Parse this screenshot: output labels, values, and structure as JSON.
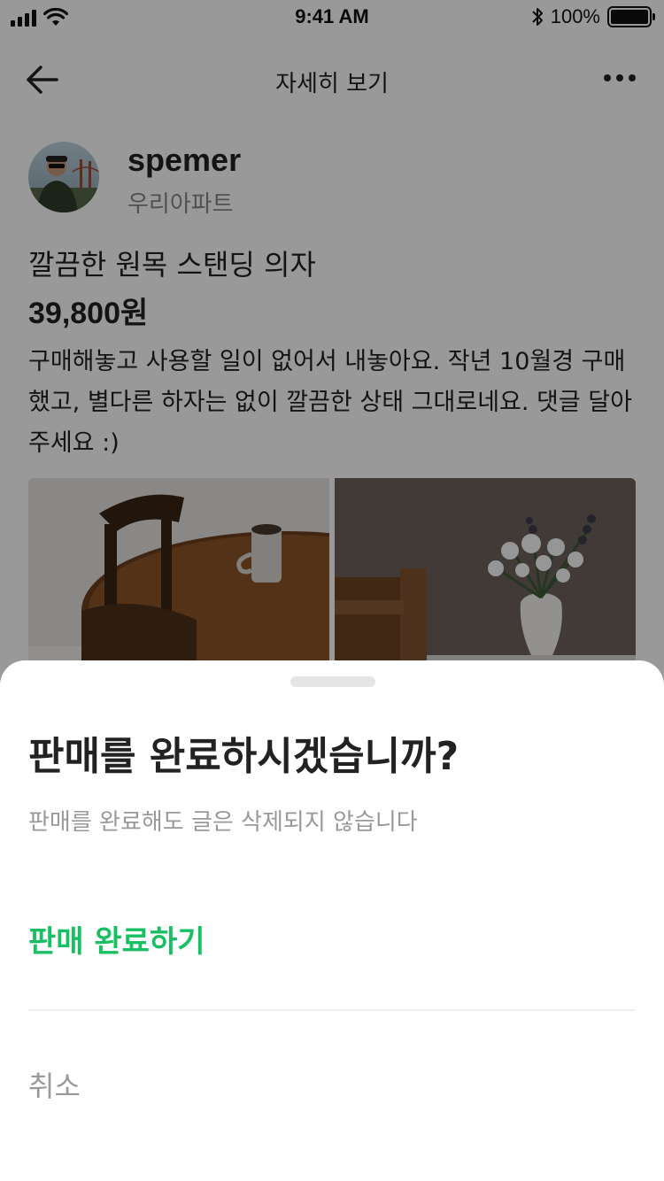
{
  "status_bar": {
    "time": "9:41 AM",
    "battery": "100%",
    "icons": [
      "signal-icon",
      "wifi-icon",
      "bluetooth-icon",
      "battery-icon"
    ]
  },
  "nav": {
    "title": "자세히 보기",
    "icons": [
      "back-arrow-icon",
      "more-icon"
    ]
  },
  "seller": {
    "name": "spemer",
    "location": "우리아파트"
  },
  "item": {
    "title": "깔끔한 원목 스탠딩 의자",
    "price": "39,800원",
    "description": "구매해놓고 사용할 일이 없어서 내놓아요. 작년 10월경 구매했고, 별다른 하자는 없이 깔끔한 상태 그대로네요. 댓글 달아주세요 :)"
  },
  "sheet": {
    "title": "판매를 완료하시겠습니까?",
    "subtitle": "판매를 완료해도 글은 삭제되지 않습니다",
    "confirm_label": "판매 완료하기",
    "cancel_label": "취소"
  },
  "colors": {
    "accent": "#1bbf63",
    "overlay": "rgba(0,0,0,0.4)"
  }
}
